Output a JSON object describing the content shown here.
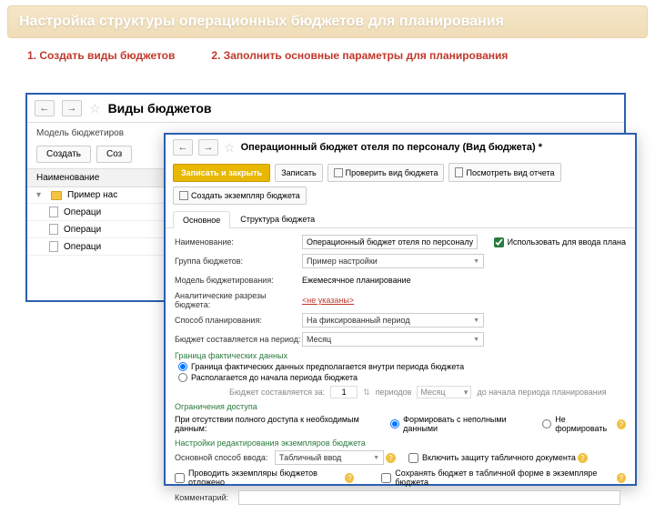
{
  "banner": "Настройка структуры операционных бюджетов для планирования",
  "caption1": "1. Создать виды бюджетов",
  "caption2": "2. Заполнить основные параметры для  планирования",
  "win1": {
    "title": "Виды  бюджетов",
    "model_label": "Модель бюджетиров",
    "btn_create": "Создать",
    "btn_create2": "Соз",
    "col_name": "Наименование",
    "rows": [
      "Пример нас",
      "Операци",
      "Операци",
      "Операци"
    ]
  },
  "win2": {
    "title": "Операционный бюджет отеля по персоналу (Вид бюджета) *",
    "btn_save_close": "Записать и закрыть",
    "btn_save": "Записать",
    "btn_check": "Проверить вид бюджета",
    "btn_view": "Посмотреть вид отчета",
    "btn_create_inst": "Создать экземпляр бюджета",
    "tab_main": "Основное",
    "tab_struct": "Структура бюджета",
    "f": {
      "name_lbl": "Наименование:",
      "name_val": "Операционный бюджет отеля по персоналу",
      "use_plan": "Использовать для ввода плана",
      "group_lbl": "Группа бюджетов:",
      "group_val": "Пример настройки",
      "model_lbl": "Модель бюджетирования:",
      "model_val": "Ежемесячное планирование",
      "analytics_lbl": "Аналитические разрезы бюджета:",
      "analytics_val": "<не указаны>",
      "plan_method_lbl": "Способ планирования:",
      "plan_method_val": "На фиксированный период",
      "period_lbl": "Бюджет составляется на период:",
      "period_val": "Месяц",
      "sect_fact": "Граница фактических данных",
      "fact_r1": "Граница фактических данных предполагается внутри периода бюджета",
      "fact_r2": "Располагается до начала периода бюджета",
      "compose_pre": "Бюджет составляется за:",
      "compose_num": "1",
      "compose_unit": "периодов",
      "compose_sel": "Месяц",
      "compose_post": "до начала периода планирования",
      "sect_access": "Ограничения доступа",
      "access_lbl": "При отсутствии полного доступа к необходимым данным:",
      "access_r1": "Формировать с неполными данными",
      "access_r2": "Не формировать",
      "sect_edit": "Настройки редактирования экземпляров бюджета",
      "input_lbl": "Основной способ ввода:",
      "input_val": "Табличный ввод",
      "protect": "Включить защиту табличного документа",
      "deferred": "Проводить экземпляры бюджетов отложено",
      "save_tab": "Сохранять бюджет в табличной форме в экземпляре бюджета",
      "comment_lbl": "Комментарий:"
    }
  }
}
